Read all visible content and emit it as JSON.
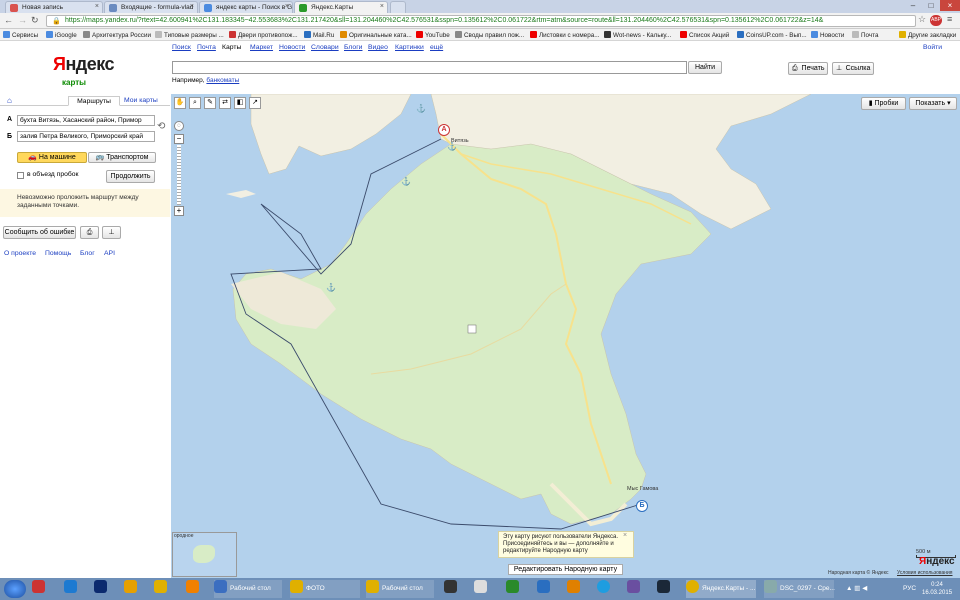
{
  "browser": {
    "tabs": [
      {
        "label": "Новая запись",
        "color": "#d9534f"
      },
      {
        "label": "Входящие - formula-vlad",
        "color": "#6a8bc0"
      },
      {
        "label": "яндекс карты - Поиск в G",
        "color": "#4b8be0"
      },
      {
        "label": "Яндекс.Карты",
        "color": "#2a9a2a"
      }
    ],
    "url": "https://maps.yandex.ru/?rtext=42.600941%2C131.183345~42.553683%2C131.217420&sll=131.204460%2C42.576531&sspn=0.135612%2C0.061722&rtm=atm&source=route&ll=131.204460%2C42.576531&spn=0.135612%2C0.061722&z=14&",
    "bookmarks": [
      {
        "label": "Сервисы",
        "color": "#4b8be0"
      },
      {
        "label": "iGoogle",
        "color": "#4b8be0"
      },
      {
        "label": "Архитектура России",
        "color": "#888"
      },
      {
        "label": "Типовые размеры ...",
        "color": "#bbb"
      },
      {
        "label": "Двери противопож...",
        "color": "#c33"
      },
      {
        "label": "Mail.Ru",
        "color": "#2a6ec0"
      },
      {
        "label": "Оригинальные ката...",
        "color": "#e08a00"
      },
      {
        "label": "YouTube",
        "color": "#e00"
      },
      {
        "label": "Своды правил пож...",
        "color": "#888"
      },
      {
        "label": "Листовки с номера...",
        "color": "#e00"
      },
      {
        "label": "Wot-news - Кальку...",
        "color": "#333"
      },
      {
        "label": "Список Акций",
        "color": "#e00"
      },
      {
        "label": "CoinsUP.com - Вып...",
        "color": "#2a6ec0"
      },
      {
        "label": "Новости",
        "color": "#4b8be0"
      },
      {
        "label": "Почта",
        "color": "#bbb"
      },
      {
        "label": "Другие закладки",
        "color": "#e0b000"
      }
    ]
  },
  "yandex": {
    "services": [
      "Поиск",
      "Почта",
      "Карты",
      "Маркет",
      "Новости",
      "Словари",
      "Блоги",
      "Видео",
      "Картинки",
      "ещё"
    ],
    "login": "Войти",
    "logo_main": "Яндекс",
    "logo_sub": "карты",
    "search_value": "",
    "find_label": "Найти",
    "example_prefix": "Например,",
    "example_link": "банкоматы",
    "print_label": "Печать",
    "link_label": "Ссылка"
  },
  "route": {
    "tab_routes": "Маршруты",
    "tab_mymaps": "Мои карты",
    "label_a": "А",
    "label_b": "Б",
    "point_a": "бухта Витязь, Хасанский район, Примор",
    "point_b": "залив Петра Великого, Приморский край",
    "mode_car": "На машине",
    "mode_transport": "Транспортом",
    "avoid_traffic": "в объезд пробок",
    "extend": "Продолжить",
    "warning": "Невозможно проложить маршрут между заданными точками.",
    "report_error": "Сообщить об ошибке",
    "footer_links": [
      "О проекте",
      "Помощь",
      "Блог",
      "API"
    ]
  },
  "map": {
    "traffic_btn": "Пробки",
    "show_btn": "Показать",
    "place_vityaz": "Витязь",
    "place_cape": "Мыс Гамова",
    "info_text": "Эту карту рисуют пользователи Яндекса. Присоединяйтесь и вы — дополняйте и редактируйте Народную карту",
    "edit_btn": "Редактировать Народную карту",
    "scale": "500 м",
    "copyright": "Народная карта © Яндекс",
    "terms": "Условия использования",
    "marker_a": "А",
    "marker_b": "Б",
    "minimap_label": "ородное"
  },
  "taskbar": {
    "items": [
      "Рабочий стол",
      "ФОТО",
      "Рабочий стол",
      "Яндекс.Карты - ...",
      "DSC_0297 - Сре..."
    ],
    "lang": "РУС",
    "time": "0:24",
    "date": "16.03.2015"
  }
}
